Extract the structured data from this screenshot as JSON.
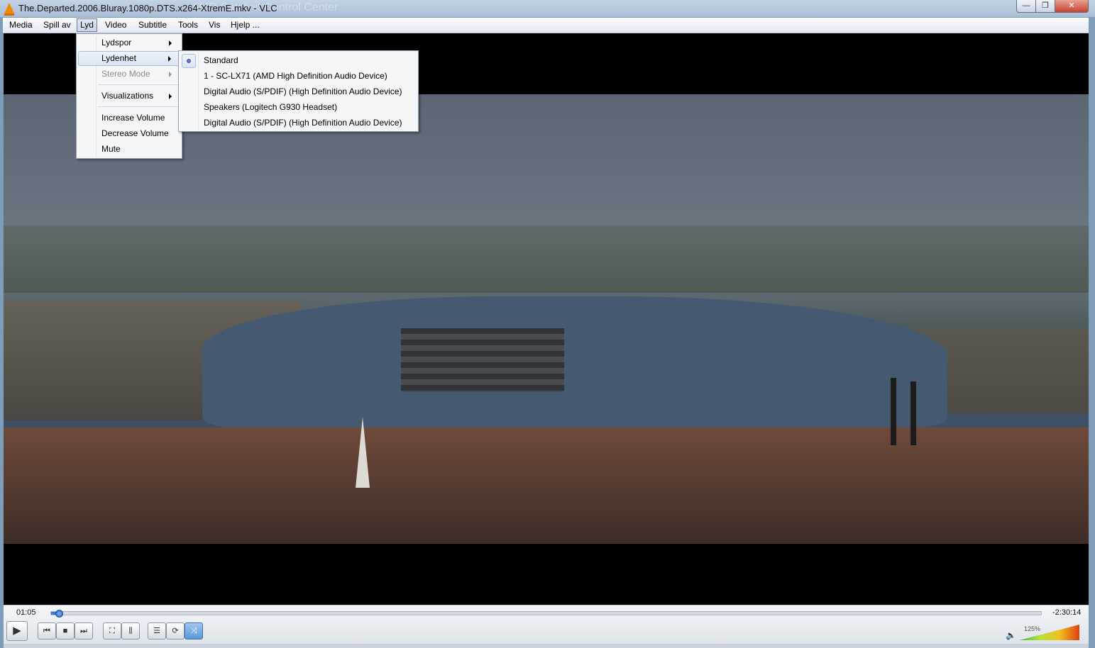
{
  "window": {
    "title": "The.Departed.2006.Bluray.1080p.DTS.x264-XtremE.mkv - VLC",
    "background_title": "AMD Catalyst Control Center",
    "controls": {
      "minimize": "—",
      "maximize": "❐",
      "close": "✕"
    }
  },
  "menubar": {
    "items": [
      {
        "label": "Media"
      },
      {
        "label": "Spill av"
      },
      {
        "label": "Lyd"
      },
      {
        "label": "Video"
      },
      {
        "label": "Subtitle"
      },
      {
        "label": "Tools"
      },
      {
        "label": "Vis"
      },
      {
        "label": "Hjelp ..."
      }
    ],
    "active": "Lyd"
  },
  "lyd_menu": {
    "items": [
      {
        "label": "Lydspor",
        "submenu": true,
        "enabled": true
      },
      {
        "label": "Lydenhet",
        "submenu": true,
        "enabled": true,
        "highlighted": true
      },
      {
        "label": "Stereo Mode",
        "submenu": true,
        "enabled": false
      },
      {
        "label": "Visualizations",
        "submenu": true,
        "enabled": true
      },
      {
        "label": "Increase Volume",
        "submenu": false,
        "enabled": true
      },
      {
        "label": "Decrease Volume",
        "submenu": false,
        "enabled": true
      },
      {
        "label": "Mute",
        "submenu": false,
        "enabled": true
      }
    ]
  },
  "lydenhet_submenu": {
    "items": [
      {
        "label": "Standard",
        "selected": true
      },
      {
        "label": "1 - SC-LX71 (AMD High Definition Audio Device)",
        "selected": false
      },
      {
        "label": "Digital Audio (S/PDIF) (High Definition Audio Device)",
        "selected": false
      },
      {
        "label": "Speakers (Logitech G930 Headset)",
        "selected": false
      },
      {
        "label": "Digital Audio (S/PDIF) (High Definition Audio Device)",
        "selected": false
      }
    ]
  },
  "playback": {
    "elapsed": "01:05",
    "remaining": "-2:30:14",
    "progress": 0.007
  },
  "controls": {
    "play": "play-icon",
    "prev": "previous-icon",
    "stop": "stop-icon",
    "next": "next-icon",
    "fullscreen": "fullscreen-icon",
    "extended": "equalizer-icon",
    "playlist": "playlist-icon",
    "loop": "loop-icon",
    "random": "shuffle-icon",
    "glyphs": {
      "play": "▶",
      "prev": "⏮",
      "stop": "■",
      "next": "⏭",
      "fullscreen": "⛶",
      "extended": "⫼",
      "playlist": "☰",
      "loop": "⟳",
      "random": "⤨",
      "speaker": "🔈"
    }
  },
  "volume": {
    "label": "125%",
    "level": 1.0
  },
  "colors": {
    "accent": "#3a7bd5",
    "close": "#c7432e"
  }
}
